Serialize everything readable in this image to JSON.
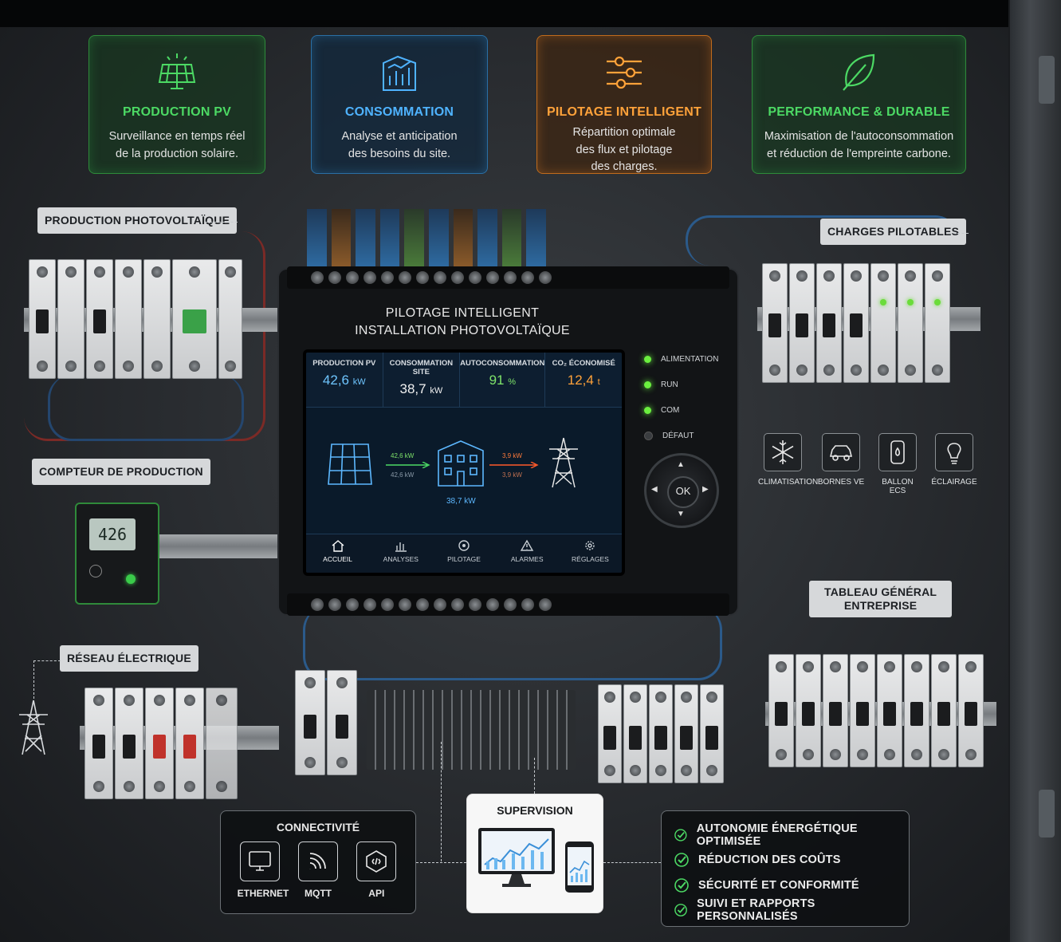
{
  "features": [
    {
      "title": "PRODUCTION PV",
      "desc1": "Surveillance en temps réel",
      "desc2": "de la production solaire.",
      "desc3": "",
      "icon": "solar-panel-icon",
      "color": "#4cd964"
    },
    {
      "title": "CONSOMMATION",
      "desc1": "Analyse et anticipation",
      "desc2": "des besoins du site.",
      "desc3": "",
      "icon": "building-chart-icon",
      "color": "#4fb3ff"
    },
    {
      "title": "PILOTAGE INTELLIGENT",
      "desc1": "Répartition optimale",
      "desc2": "des flux et pilotage",
      "desc3": "des charges.",
      "icon": "sliders-icon",
      "color": "#ffa23a"
    },
    {
      "title": "PERFORMANCE & DURABLE",
      "desc1": "Maximisation de l'autoconsommation",
      "desc2": "et réduction de l'empreinte carbone.",
      "desc3": "",
      "icon": "leaf-icon",
      "color": "#4cd964"
    }
  ],
  "labels": {
    "production_pv": "PRODUCTION PHOTOVOLTAÏQUE",
    "compteur": "COMPTEUR DE PRODUCTION",
    "reseau": "RÉSEAU ÉLECTRIQUE",
    "charges": "CHARGES PILOTABLES",
    "tableau_l1": "TABLEAU GÉNÉRAL",
    "tableau_l2": "ENTREPRISE"
  },
  "meter": {
    "reading": "426"
  },
  "controller": {
    "title_l1": "PILOTAGE INTELLIGENT",
    "title_l2": "INSTALLATION PHOTOVOLTAÏQUE",
    "kpis": [
      {
        "label": "PRODUCTION PV",
        "value": "42,6",
        "unit": "kW"
      },
      {
        "label": "CONSOMMATION SITE",
        "value": "38,7",
        "unit": "kW"
      },
      {
        "label": "AUTOCONSOMMATION",
        "value": "91",
        "unit": "%"
      },
      {
        "label": "CO₂ ÉCONOMISÉ",
        "value": "12,4",
        "unit": "t"
      }
    ],
    "flow": {
      "pv_to_site_a": "42,6 kW",
      "pv_to_site_b": "42,6 kW",
      "grid_a": "3,9 kW",
      "grid_b": "3,9 kW",
      "site": "38,7 kW"
    },
    "nav": [
      "ACCUEIL",
      "ANALYSES",
      "PILOTAGE",
      "ALARMES",
      "RÉGLAGES"
    ],
    "leds": [
      {
        "label": "ALIMENTATION",
        "state": "on"
      },
      {
        "label": "RUN",
        "state": "on"
      },
      {
        "label": "COM",
        "state": "on"
      },
      {
        "label": "DÉFAUT",
        "state": "off"
      }
    ],
    "ok_label": "OK"
  },
  "loads": [
    {
      "label": "CLIMATISATION",
      "icon": "snowflake-icon"
    },
    {
      "label": "BORNES VE",
      "icon": "car-icon"
    },
    {
      "label": "BALLON ECS",
      "icon": "water-heater-icon"
    },
    {
      "label": "ÉCLAIRAGE",
      "icon": "bulb-icon"
    }
  ],
  "connectivity": {
    "title": "CONNECTIVITÉ",
    "items": [
      "ETHERNET",
      "MQTT",
      "API"
    ]
  },
  "supervision": {
    "title": "SUPERVISION"
  },
  "benefits": [
    "AUTONOMIE ÉNERGÉTIQUE OPTIMISÉE",
    "RÉDUCTION DES COÛTS",
    "SÉCURITÉ ET CONFORMITÉ",
    "SUIVI ET RAPPORTS PERSONNALISÉS"
  ]
}
